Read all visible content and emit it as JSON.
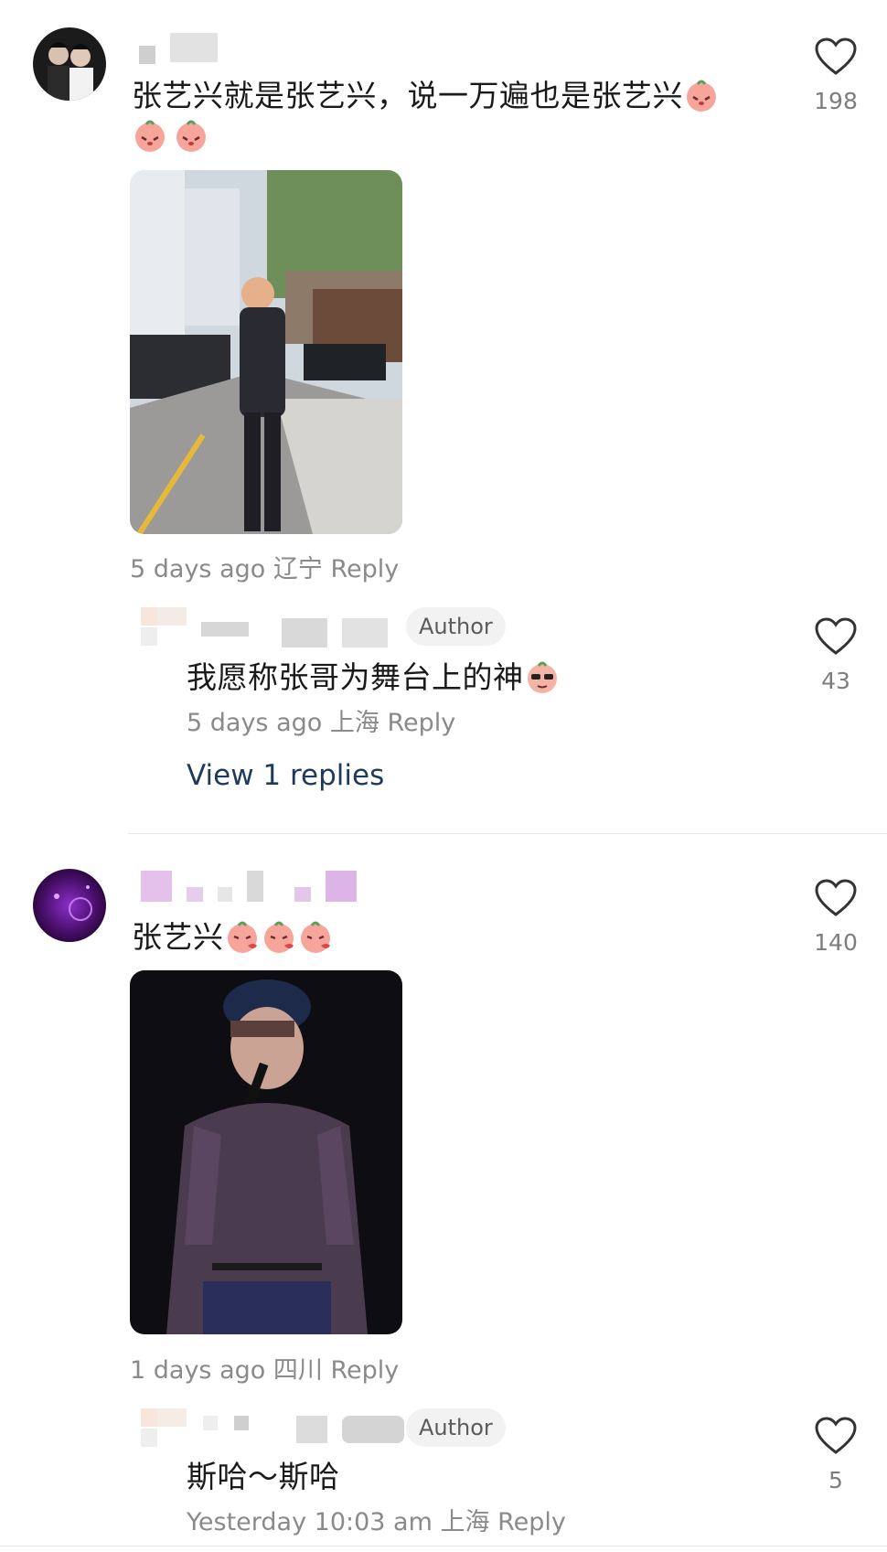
{
  "comments": [
    {
      "text": "张艺兴就是张艺兴，说一万遍也是张艺兴",
      "likes": "198",
      "time": "5 days ago",
      "location": "辽宁",
      "reply_label": "Reply",
      "reply": {
        "badge": "Author",
        "text": "我愿称张哥为舞台上的神",
        "likes": "43",
        "time": "5 days ago",
        "location": "上海",
        "reply_label": "Reply"
      },
      "view_replies": "View 1 replies"
    },
    {
      "text": "张艺兴",
      "likes": "140",
      "time": "1 days ago",
      "location": "四川",
      "reply_label": "Reply",
      "reply": {
        "badge": "Author",
        "text": "斯哈～斯哈",
        "likes": "5",
        "time": "Yesterday 10:03 am",
        "location": "上海",
        "reply_label": "Reply"
      }
    }
  ],
  "icons": {
    "like": "heart-outline-icon",
    "emoji_peach": "peach-emoji-icon"
  },
  "colors": {
    "link": "#1f3a5a",
    "meta": "#8a8a8a",
    "badge_bg": "#f2f2f2"
  }
}
